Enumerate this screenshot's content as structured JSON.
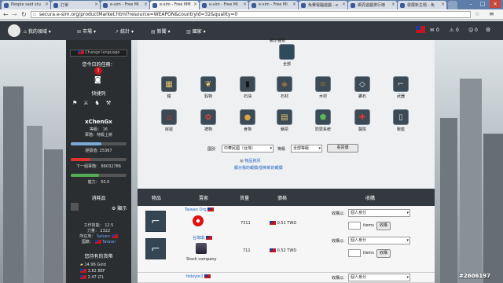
{
  "browser": {
    "tabs": [
      {
        "label": "People said stu"
      },
      {
        "label": "訂單"
      },
      {
        "label": "e-sim - Free Mi"
      },
      {
        "label": "e-sim - Free MM"
      },
      {
        "label": "e-sim - Free MI"
      },
      {
        "label": "e-sim - Free MI"
      },
      {
        "label": "免費電腦遊戲 - e"
      },
      {
        "label": "網頁遊戲排行榜"
      },
      {
        "label": "發展新主題 - 免"
      }
    ],
    "url": "secura.e-sim.org/productMarket.html?resource=WEAPON&countryId=32&quality=0"
  },
  "nav": {
    "items": [
      "我的領域",
      "市場",
      "統計",
      "新聞",
      "國家"
    ],
    "counters": [
      "0",
      "0",
      "0"
    ]
  },
  "left": {
    "change_language": "Change language",
    "daily_tasks": "您今日的任務：",
    "quick_link": "快捷列",
    "username": "xChenGx",
    "level": "等級： 16",
    "rank": "軍階：特級上將",
    "xp": "經驗值: 25367",
    "next_rank": "下一個軍階： 86032786",
    "health": "健力： 50.0",
    "notifications": "消耗品",
    "show": "顯示",
    "work_skill": "工作技能： 12.5",
    "strength": "力量： 2322",
    "location_label": "所在地：",
    "location_value": "Saluen",
    "citizenship_label": "國籍：",
    "citizenship_value": "Taiwan",
    "money_title": "您持有的貨幣",
    "gold": "14.96 Gold",
    "bef": "3.82 BEF",
    "ltl": "2.47 LTL",
    "xp_fraction": 0.55,
    "next_fraction": 0.35,
    "health_fraction": 0.5
  },
  "market": {
    "header": "顯示種類",
    "all": "全部",
    "categories": [
      "鐵",
      "穀物",
      "石油",
      "石材",
      "木材",
      "鑽石",
      "武器",
      "房屋",
      "禮物",
      "食物",
      "鑄票",
      "防禦系統",
      "醫院",
      "鞍座"
    ],
    "country_label": "國別",
    "country_value": "中華民國（台灣）",
    "quality_label": "等級",
    "quality_value": "全部等級",
    "view_button": "看貨價",
    "link1": "物品資訊",
    "link2": "顯示我的報價/發佈新的報價",
    "table_headers": [
      "物品",
      "賣家",
      "貨量",
      "價格",
      "收購"
    ],
    "rows": [
      {
        "seller": "Taiwan Org",
        "company": "",
        "stock": "7311",
        "price": "0.51 TWD",
        "buy_as_label": "收購以:",
        "buy_as": "個人身分",
        "items_label": "items",
        "buy": "收購"
      },
      {
        "seller": "台灣琪",
        "company": "Stock company",
        "stock": "711",
        "price": "0.52 TWD",
        "buy_as_label": "收購以:",
        "buy_as": "個人身分",
        "items_label": "items",
        "buy": "收購"
      },
      {
        "seller": "ttdoyor2",
        "company": "",
        "stock": "",
        "price": "",
        "buy_as_label": "收購以:",
        "buy_as": "個人身分",
        "items_label": "",
        "buy": ""
      }
    ]
  },
  "watermark": "#2606197"
}
